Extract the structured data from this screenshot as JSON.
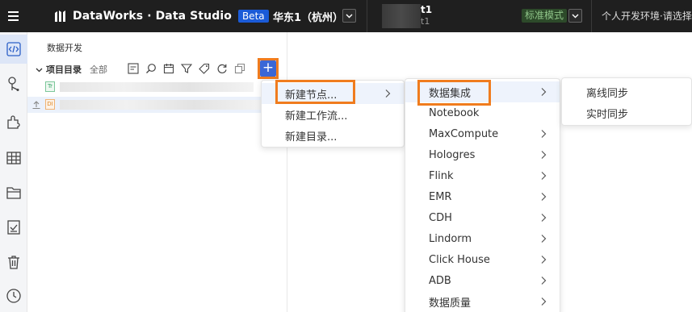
{
  "topbar": {
    "brand": "DataWorks · Data Studio",
    "beta": "Beta",
    "region": "华东1（杭州）",
    "workspace_name": "t1",
    "workspace_sub": "t1",
    "mode": "标准模式",
    "env": "个人开发环境·请选择"
  },
  "rail": {
    "icons": [
      "code-icon",
      "git-branch-icon",
      "puzzle-icon",
      "table-icon",
      "folder-icon",
      "checklist-icon",
      "trash-icon",
      "clock-icon"
    ]
  },
  "panel": {
    "title": "数据开发",
    "tree_label": "项目目录",
    "tree_filter": "全部",
    "rows": [
      {
        "badge": "Tr"
      },
      {
        "badge": "DI"
      }
    ]
  },
  "menu1": {
    "items": [
      {
        "label": "新建节点...",
        "submenu": true
      },
      {
        "label": "新建工作流...",
        "submenu": false
      },
      {
        "label": "新建目录...",
        "submenu": false
      }
    ]
  },
  "menu2": {
    "items": [
      {
        "label": "数据集成",
        "submenu": true
      },
      {
        "label": "Notebook",
        "submenu": false
      },
      {
        "label": "MaxCompute",
        "submenu": true
      },
      {
        "label": "Hologres",
        "submenu": true
      },
      {
        "label": "Flink",
        "submenu": true
      },
      {
        "label": "EMR",
        "submenu": true
      },
      {
        "label": "CDH",
        "submenu": true
      },
      {
        "label": "Lindorm",
        "submenu": true
      },
      {
        "label": "Click House",
        "submenu": true
      },
      {
        "label": "ADB",
        "submenu": true
      },
      {
        "label": "数据质量",
        "submenu": true
      }
    ]
  },
  "menu3": {
    "items": [
      {
        "label": "离线同步"
      },
      {
        "label": "实时同步"
      }
    ]
  },
  "colors": {
    "topbar": "#1f1f1f",
    "accent": "#3a67d6",
    "highlight": "#f07c1e",
    "beta": "#1b5bd7"
  }
}
